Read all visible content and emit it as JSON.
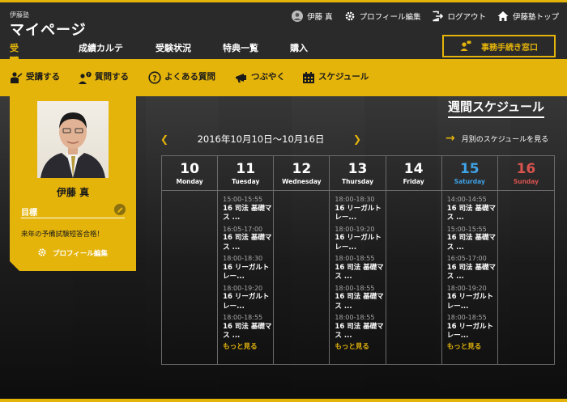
{
  "header": {
    "brand_small": "伊藤塾",
    "brand_title": "マイページ",
    "user_name": "伊藤 真",
    "profile_edit": "プロフィール編集",
    "logout": "ログアウト",
    "home_link": "伊藤塾トップ",
    "office_button": "事務手続き窓口",
    "tabs": [
      "受講講座",
      "成績カルテ",
      "受験状況",
      "特典一覧",
      "購入"
    ]
  },
  "subnav": [
    "受講する",
    "質問する",
    "よくある質問",
    "つぶやく",
    "スケジュール"
  ],
  "profile": {
    "name": "伊藤 真",
    "goal_label": "目標",
    "goal_text": "来年の予備試験短答合格！",
    "edit_label": "プロフィール編集"
  },
  "schedule": {
    "title": "週間スケジュール",
    "month_link": "月別のスケジュールを見る",
    "range": "2016年10月10日〜10月16日",
    "more": "もっと見る",
    "days": [
      {
        "num": "10",
        "name": "Monday",
        "events": []
      },
      {
        "num": "11",
        "name": "Tuesday",
        "events": [
          {
            "time": "15:00-15:55",
            "title": "16 司法 基礎マス ..."
          },
          {
            "time": "16:05-17:00",
            "title": "16 司法 基礎マス ..."
          },
          {
            "time": "18:00-18:30",
            "title": "16 リーガルトレー..."
          },
          {
            "time": "18:00-19:20",
            "title": "16 リーガルトレー..."
          },
          {
            "time": "18:00-18:55",
            "title": "16 司法 基礎マス ..."
          }
        ]
      },
      {
        "num": "12",
        "name": "Wednesday",
        "events": []
      },
      {
        "num": "13",
        "name": "Thursday",
        "events": [
          {
            "time": "18:00-18:30",
            "title": "16 リーガルトレー..."
          },
          {
            "time": "18:00-19:20",
            "title": "16 リーガルトレー..."
          },
          {
            "time": "18:00-18:55",
            "title": "16 司法 基礎マス ..."
          },
          {
            "time": "18:00-18:55",
            "title": "16 司法 基礎マス ..."
          },
          {
            "time": "18:00-18:55",
            "title": "16 司法 基礎マス ..."
          }
        ]
      },
      {
        "num": "14",
        "name": "Friday",
        "events": []
      },
      {
        "num": "15",
        "name": "Saturday",
        "events": [
          {
            "time": "14:00-14:55",
            "title": "16 司法 基礎マス ..."
          },
          {
            "time": "15:00-15:55",
            "title": "16 司法 基礎マス ..."
          },
          {
            "time": "16:05-17:00",
            "title": "16 司法 基礎マス ..."
          },
          {
            "time": "18:00-19:20",
            "title": "16 リーガルトレー..."
          },
          {
            "time": "18:00-18:55",
            "title": "16 リーガルトレー..."
          }
        ]
      },
      {
        "num": "16",
        "name": "Sunday",
        "events": []
      }
    ]
  }
}
